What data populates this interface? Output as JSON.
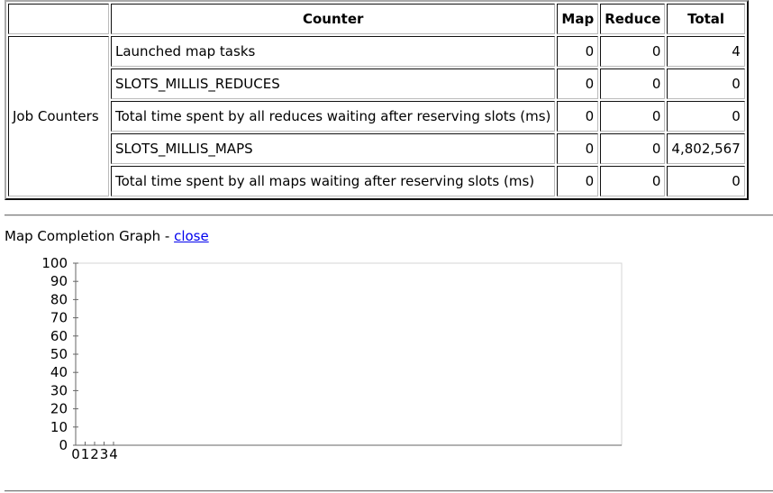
{
  "table": {
    "headers": {
      "blank": "",
      "counter": "Counter",
      "map": "Map",
      "reduce": "Reduce",
      "total": "Total"
    },
    "group": "Job Counters",
    "rows": [
      {
        "counter": "Launched map tasks",
        "map": "0",
        "reduce": "0",
        "total": "4"
      },
      {
        "counter": "SLOTS_MILLIS_REDUCES",
        "map": "0",
        "reduce": "0",
        "total": "0"
      },
      {
        "counter": "Total time spent by all reduces waiting after reserving slots (ms)",
        "map": "0",
        "reduce": "0",
        "total": "0"
      },
      {
        "counter": "SLOTS_MILLIS_MAPS",
        "map": "0",
        "reduce": "0",
        "total": "4,802,567"
      },
      {
        "counter": "Total time spent by all maps waiting after reserving slots (ms)",
        "map": "0",
        "reduce": "0",
        "total": "0"
      }
    ]
  },
  "graph": {
    "title": "Map Completion Graph - ",
    "close_link": "close"
  },
  "chart_data": {
    "type": "bar",
    "categories": [
      "0",
      "1",
      "2",
      "3",
      "4"
    ],
    "values": [
      0,
      0,
      0,
      0,
      0
    ],
    "title": "Map Completion Graph",
    "xlabel": "",
    "ylabel": "",
    "ylim": [
      0,
      100
    ],
    "yticks": [
      "0",
      "10",
      "20",
      "30",
      "40",
      "50",
      "60",
      "70",
      "80",
      "90",
      "100"
    ],
    "grid": false
  }
}
